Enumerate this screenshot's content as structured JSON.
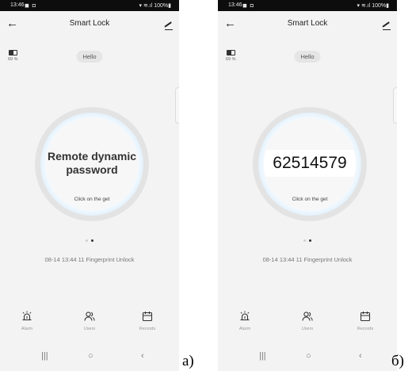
{
  "screens": [
    {
      "status": {
        "time": "13:46",
        "left_icons": "◼ ◘",
        "right_text": "▾ ≋.ıl 100%▮"
      },
      "nav": {
        "back": "←",
        "title": "Smart Lock"
      },
      "battery_pct": "69 %",
      "greeting": "Hello",
      "main_label": "Remote dynamic password",
      "hint": "Click on the get",
      "record": "08-14 13:44  11 Fingerprint Unlock",
      "tabs": [
        "Alarm",
        "Users",
        "Records"
      ],
      "sysnav": {
        "recents": "|||",
        "home": "○",
        "back": "‹"
      },
      "caption": "a)"
    },
    {
      "status": {
        "time": "13:46",
        "left_icons": "◼ ◘",
        "right_text": "▾ ≋.ıl 100%▮"
      },
      "nav": {
        "back": "←",
        "title": "Smart Lock"
      },
      "battery_pct": "69 %",
      "greeting": "Hello",
      "password": "62514579",
      "hint": "Click on the get",
      "record": "08-14 13:44  11 Fingerprint Unlock",
      "tabs": [
        "Alarm",
        "Users",
        "Records"
      ],
      "sysnav": {
        "recents": "|||",
        "home": "○",
        "back": "‹"
      },
      "caption": "б)"
    }
  ],
  "colors": {
    "accent_ring": "#a6d0f0",
    "background": "#f3f3f3",
    "statusbar": "#0d0d0d"
  },
  "icons": [
    "back-arrow-icon",
    "edit-icon",
    "battery-icon",
    "alarm-icon",
    "users-icon",
    "records-icon"
  ]
}
